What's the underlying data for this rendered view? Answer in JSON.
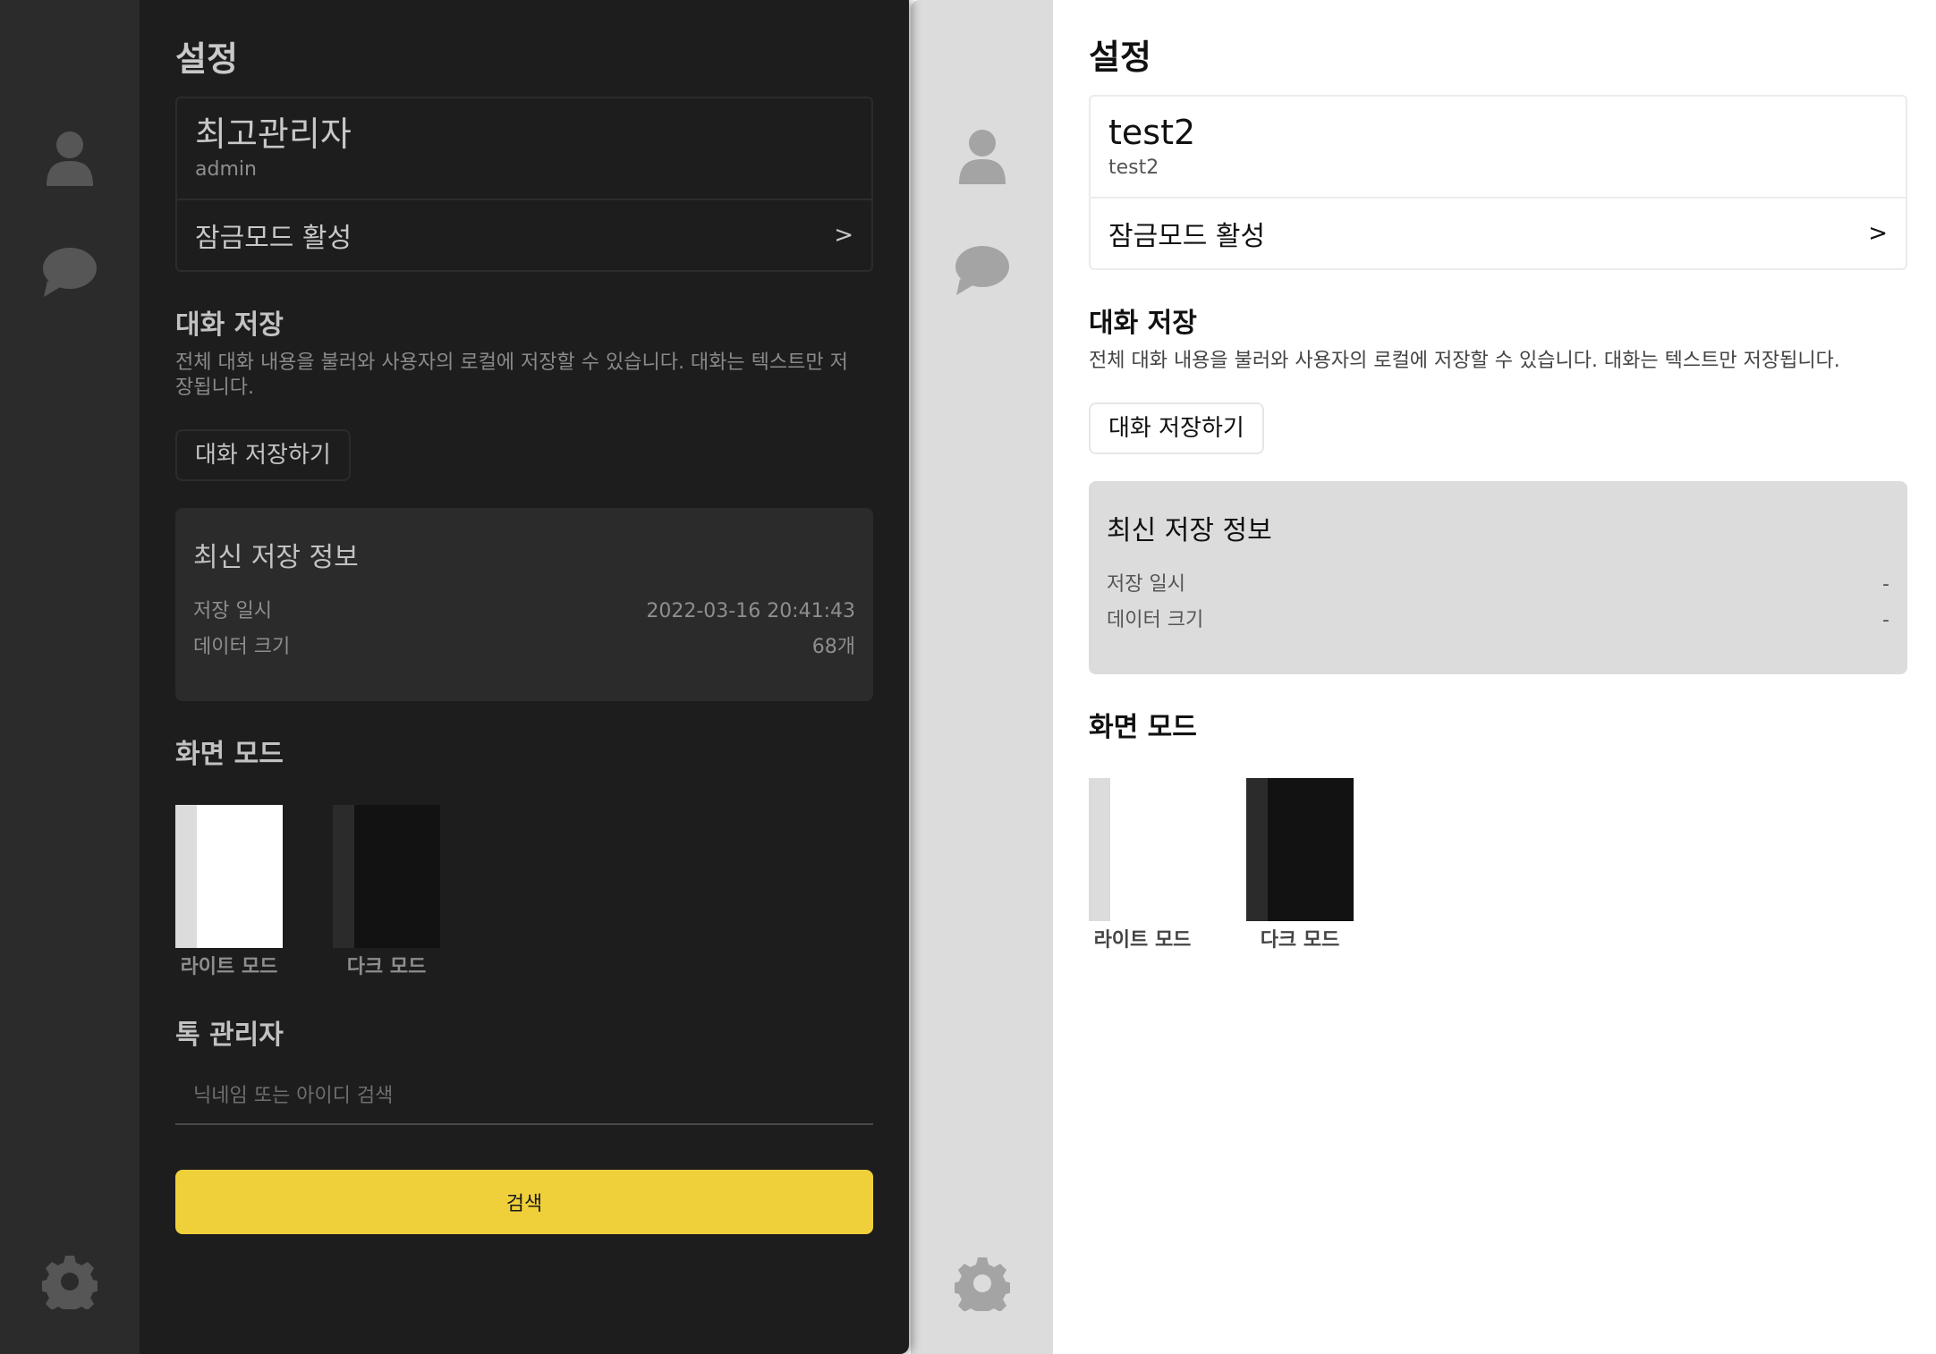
{
  "dark_window": {
    "title": "설정",
    "profile": {
      "name": "최고관리자",
      "id": "admin"
    },
    "lock_mode": {
      "label": "잠금모드 활성",
      "chevron": ">"
    },
    "chat_save": {
      "title": "대화 저장",
      "description": "전체 대화 내용을 불러와 사용자의 로컬에 저장할 수 있습니다. 대화는 텍스트만 저장됩니다.",
      "button": "대화 저장하기"
    },
    "latest_info": {
      "title": "최신 저장 정보",
      "rows": [
        {
          "label": "저장 일시",
          "value": "2022-03-16 20:41:43"
        },
        {
          "label": "데이터 크기",
          "value": "68개"
        }
      ]
    },
    "screen_mode": {
      "title": "화면 모드",
      "options": [
        {
          "label": "라이트 모드"
        },
        {
          "label": "다크 모드"
        }
      ]
    },
    "talk_admin": {
      "title": "톡 관리자",
      "search_placeholder": "닉네임 또는 아이디 검색",
      "search_button": "검색"
    }
  },
  "light_window": {
    "title": "설정",
    "profile": {
      "name": "test2",
      "id": "test2"
    },
    "lock_mode": {
      "label": "잠금모드 활성",
      "chevron": ">"
    },
    "chat_save": {
      "title": "대화 저장",
      "description": "전체 대화 내용을 불러와 사용자의 로컬에 저장할 수 있습니다. 대화는 텍스트만 저장됩니다.",
      "button": "대화 저장하기"
    },
    "latest_info": {
      "title": "최신 저장 정보",
      "rows": [
        {
          "label": "저장 일시",
          "value": "-"
        },
        {
          "label": "데이터 크기",
          "value": "-"
        }
      ]
    },
    "screen_mode": {
      "title": "화면 모드",
      "options": [
        {
          "label": "라이트 모드"
        },
        {
          "label": "다크 모드"
        }
      ]
    }
  },
  "icons": {
    "profile": "person-icon",
    "chats": "chat-bubble-icon",
    "settings": "gear-icon"
  },
  "colors": {
    "dark_bg": "#1d1d1d",
    "dark_sidebar": "#2b2b2b",
    "light_bg": "#ffffff",
    "light_sidebar": "#dcdcdc",
    "accent": "#f0d03a"
  }
}
